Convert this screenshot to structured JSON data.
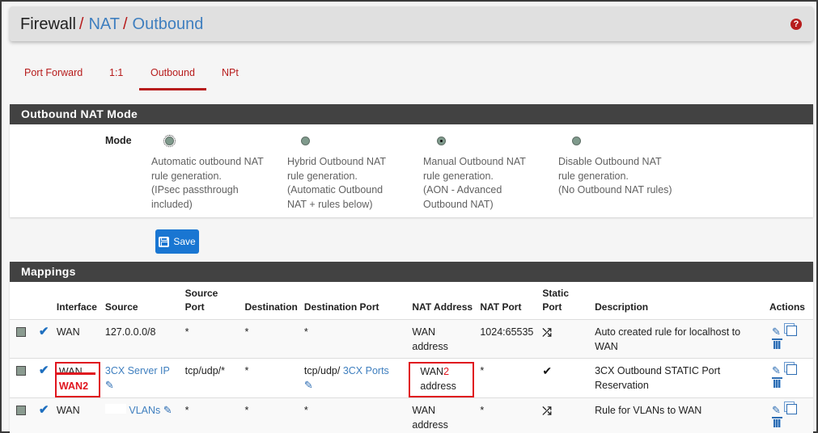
{
  "breadcrumb": {
    "items": [
      "Firewall",
      "NAT",
      "Outbound"
    ],
    "separator": "/"
  },
  "header": {
    "help_icon": "question-circle-icon"
  },
  "tabs": [
    {
      "label": "Port Forward",
      "active": false
    },
    {
      "label": "1:1",
      "active": false
    },
    {
      "label": "Outbound",
      "active": true
    },
    {
      "label": "NPt",
      "active": false
    }
  ],
  "mode_panel": {
    "title": "Outbound NAT Mode",
    "label": "Mode",
    "options": [
      {
        "desc": "Automatic outbound NAT\nrule generation.\n(IPsec passthrough\nincluded)",
        "checked": false,
        "focused": true
      },
      {
        "desc": "Hybrid Outbound NAT\nrule generation.\n(Automatic Outbound\nNAT + rules below)",
        "checked": false
      },
      {
        "desc": "Manual Outbound NAT\nrule generation.\n(AON - Advanced\nOutbound NAT)",
        "checked": true
      },
      {
        "desc": "Disable Outbound NAT\nrule generation.\n(No Outbound NAT rules)",
        "checked": false
      }
    ]
  },
  "save_button": {
    "label": "Save",
    "icon": "floppy-disk-icon"
  },
  "mappings": {
    "title": "Mappings",
    "columns": {
      "interface": "Interface",
      "source": "Source",
      "source_port": "Source Port",
      "destination": "Destination",
      "destination_port": "Destination Port",
      "nat_address": "NAT Address",
      "nat_port": "NAT Port",
      "static_port": "Static Port",
      "description": "Description",
      "actions": "Actions"
    },
    "rows": [
      {
        "interface": "WAN",
        "source": "127.0.0.0/8",
        "source_port": "*",
        "destination": "*",
        "destination_port": "*",
        "nat_address_1": "WAN",
        "nat_address_2": "address",
        "nat_port": "1024:65535",
        "static_port": "shuffle-icon",
        "description": "Auto created rule for localhost to WAN"
      },
      {
        "interface": "WAN",
        "interface_annotation": "WAN2",
        "source": "3CX Server IP",
        "source_port": "tcp/udp/*",
        "destination": "*",
        "destination_port_prefix": "tcp/udp/",
        "destination_port_alias": "3CX Ports",
        "nat_address_1": "WAN",
        "nat_address_annotation": "2",
        "nat_address_2": "address",
        "nat_port": "*",
        "static_port": "check-icon",
        "description": "3CX Outbound STATIC Port Reservation"
      },
      {
        "interface": "WAN",
        "source": "VLANs",
        "source_port": "*",
        "destination": "*",
        "destination_port": "*",
        "nat_address_1": "WAN",
        "nat_address_2": "address",
        "nat_port": "*",
        "static_port": "shuffle-icon",
        "description": "Rule for VLANs to WAN"
      }
    ]
  },
  "colors": {
    "accent_red": "#b71c1c",
    "link_blue": "#3f7fbf",
    "panel_heading": "#424242",
    "save_blue": "#1976d2",
    "annotation_red": "#e0151e"
  }
}
